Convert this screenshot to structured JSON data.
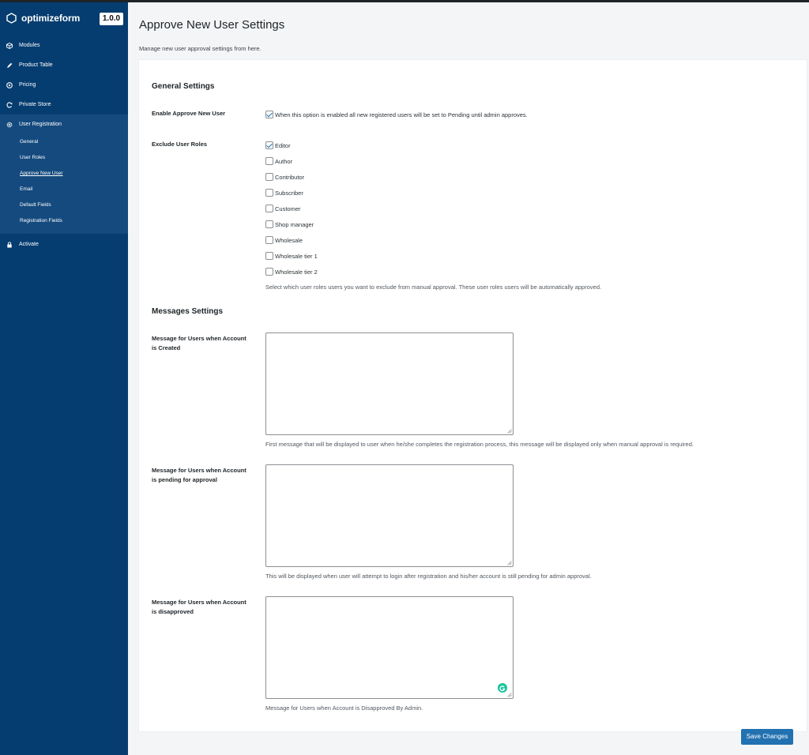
{
  "app": {
    "brand_name": "optimizeform",
    "version": "1.0.0"
  },
  "sidebar": {
    "items": [
      {
        "label": "Modules",
        "icon": "cube-icon"
      },
      {
        "label": "Product Table",
        "icon": "pencil-icon"
      },
      {
        "label": "Pricing",
        "icon": "tag-icon"
      },
      {
        "label": "Private Store",
        "icon": "refresh-icon"
      },
      {
        "label": "User Registration",
        "icon": "gear-icon"
      }
    ],
    "sub_items": [
      "General",
      "User Roles",
      "Approve New User",
      "Email",
      "Default Fields",
      "Registration Fields"
    ],
    "current_sub": "Approve New User",
    "activate": {
      "label": "Activate",
      "icon": "lock-icon"
    }
  },
  "page": {
    "title": "Approve New User Settings",
    "description": "Manage new user approval settings from here."
  },
  "general": {
    "title": "General Settings",
    "enable_label": "Enable Approve New User",
    "enable_text": "When this option is enabled all new registered users will be set to Pending until admin approves.",
    "enable_checked": true,
    "exclude_label": "Exclude User Roles",
    "roles": [
      {
        "label": "Editor",
        "checked": true
      },
      {
        "label": "Author",
        "checked": false
      },
      {
        "label": "Contributor",
        "checked": false
      },
      {
        "label": "Subscriber",
        "checked": false
      },
      {
        "label": "Customer",
        "checked": false
      },
      {
        "label": "Shop manager",
        "checked": false
      },
      {
        "label": "Wholesale",
        "checked": false
      },
      {
        "label": "Wholesale tier 1",
        "checked": false
      },
      {
        "label": "Wholesale tier 2",
        "checked": false
      }
    ],
    "exclude_help": "Select which user roles users you want to exclude from manual approval. These user roles users will be automatically approved."
  },
  "messages": {
    "title": "Messages Settings",
    "created": {
      "label_line1": "Message for Users when Account",
      "label_line2": "is Created",
      "value": "",
      "help": "First message that will be displayed to user when he/she completes the registration process, this message will be displayed only when manual approval is required."
    },
    "pending": {
      "label_line1": "Message for Users when Account",
      "label_line2": "is pending for approval",
      "value": "",
      "help": "This will be displayed when user will attempt to login after registration and his/her account is still pending for admin approval."
    },
    "disapproved": {
      "label_line1": "Message for Users when Account",
      "label_line2": "is disapproved",
      "value": "",
      "help": "Message for Users when Account is Disapproved By Admin."
    }
  },
  "actions": {
    "save_label": "Save Changes"
  },
  "colors": {
    "sidebar_bg": "#063d70",
    "sidebar_active_bg": "#144a7e",
    "primary_button": "#2271b1",
    "grammarly": "#15c39a"
  }
}
